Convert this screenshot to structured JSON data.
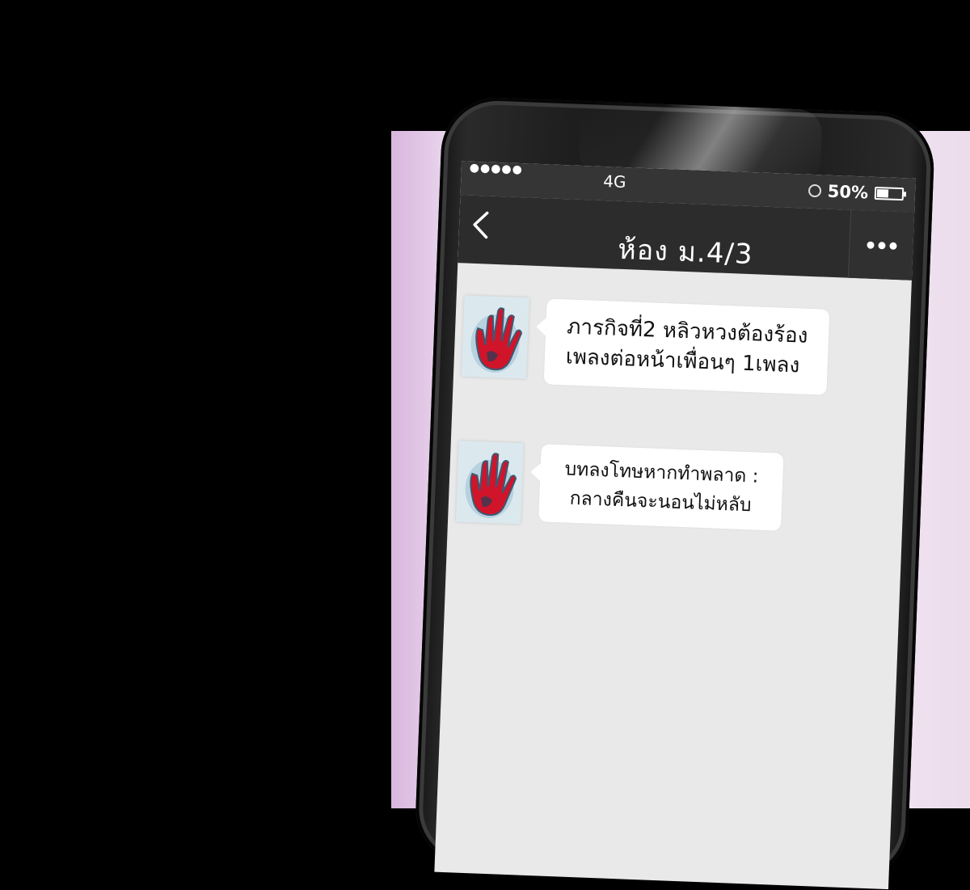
{
  "status_bar": {
    "signal": "●●●●●",
    "network": "4G",
    "battery_percent": "50%",
    "battery_level": 0.5
  },
  "header": {
    "title": "ห้อง ม.4/3",
    "back_icon": "chevron-left-icon",
    "more_icon": "more-dots-icon"
  },
  "messages": [
    {
      "avatar": "red-hand-avatar",
      "lines": [
        "ภารกิจที่2 หลิวหวงต้องร้อง",
        "เพลงต่อหน้าเพื่อนๆ 1เพลง"
      ]
    },
    {
      "avatar": "red-hand-avatar",
      "lines": [
        "บทลงโทษหากทำพลาด :",
        "กลางคืนจะนอนไม่หลับ"
      ]
    }
  ],
  "colors": {
    "header_bg": "#2c2c2c",
    "chat_bg": "#e9e9e9",
    "bubble_bg": "#ffffff",
    "hand_red": "#d0142a"
  }
}
